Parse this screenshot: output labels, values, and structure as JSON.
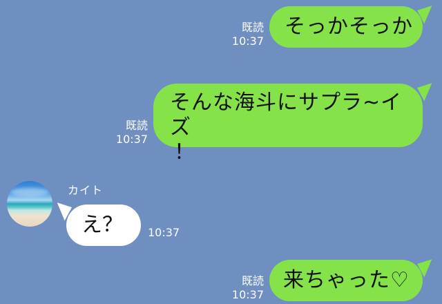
{
  "messages": [
    {
      "direction": "outgoing",
      "text": "そっかそっか",
      "read_label": "既読",
      "time": "10:37"
    },
    {
      "direction": "outgoing",
      "text_line1": "そんな海斗にサプラ~イズ",
      "text_line2": "！",
      "read_label": "既読",
      "time": "10:37"
    },
    {
      "direction": "incoming",
      "sender": "カイト",
      "avatar": "beach-avatar",
      "text": "え？",
      "time": "10:37"
    },
    {
      "direction": "outgoing",
      "text": "来ちゃった♡",
      "read_label": "既読",
      "time": "10:37"
    }
  ],
  "colors": {
    "background": "#6f8fc1",
    "outgoing_bubble": "#85e249",
    "incoming_bubble": "#ffffff"
  }
}
